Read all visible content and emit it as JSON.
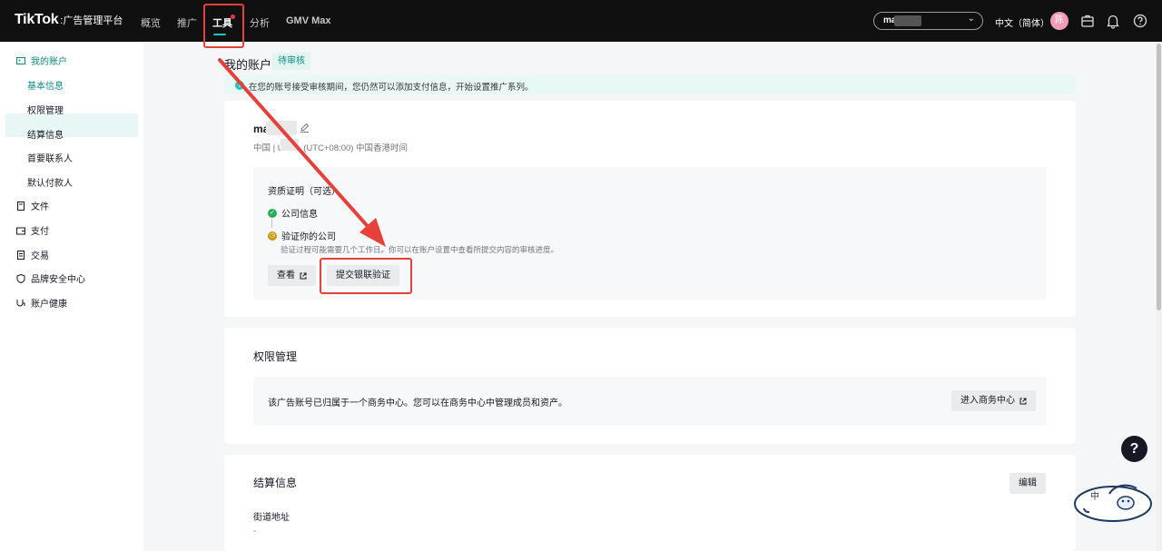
{
  "topbar": {
    "logo": "TikTok",
    "logo_sub": ":广告管理平台",
    "nav": [
      "概览",
      "推广",
      "工具",
      "分析",
      "GMV Max"
    ],
    "active_nav": "工具",
    "account": "ma",
    "language": "中文（简体）",
    "avatar": "陈"
  },
  "sidebar": {
    "my_account": "我的账户",
    "sub_items": [
      "基本信息",
      "权限管理",
      "结算信息",
      "首要联系人",
      "默认付款人"
    ],
    "active_sub": "基本信息",
    "items": [
      "文件",
      "支付",
      "交易",
      "品牌安全中心",
      "账户健康"
    ]
  },
  "main": {
    "title": "我的账户",
    "status": "待审核",
    "notice": "在您的账号接受审核期间，您仍然可以添加支付信息，开始设置推广系列。",
    "account_name": "ma",
    "account_meta": "中国 | USD · (UTC+08:00) 中国香港时间",
    "qualification": {
      "title": "资质证明（可选）",
      "step1": "公司信息",
      "step2": "验证你的公司",
      "desc": "验证过程可能需要几个工作日。你可以在账户设置中查看所提交内容的审核进度。",
      "view_button": "查看",
      "submit_button": "提交银联验证"
    },
    "permissions": {
      "title": "权限管理",
      "text": "该广告账号已归属于一个商务中心。您可以在商务中心中管理成员和资产。",
      "button": "进入商务中心"
    },
    "billing": {
      "title": "结算信息",
      "edit_button": "编辑",
      "street_label": "街道地址",
      "street_value": "-"
    }
  },
  "help": "?",
  "mascot_text": "中",
  "colors": {
    "accent": "#25c4b7",
    "annotation": "#e5413a",
    "topbar": "#101010"
  }
}
